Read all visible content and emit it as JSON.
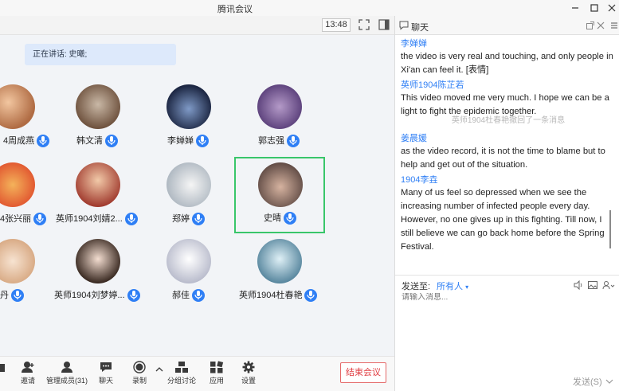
{
  "window": {
    "title": "腾讯会议"
  },
  "meeting": {
    "time": "13:48",
    "speaking": "正在讲话: 史曦;",
    "participants": [
      {
        "name": "4周成燕",
        "avatar_color": "#d99a6c"
      },
      {
        "name": "韩文清",
        "avatar_color": "#8a6f57"
      },
      {
        "name": "李婵婵",
        "avatar_color": "#2f3b58"
      },
      {
        "name": "郭志强",
        "avatar_color": "#8a6ca8"
      },
      {
        "name": "4张兴丽",
        "avatar_color": "#e67d3d"
      },
      {
        "name": "英师1904刘婧2...",
        "avatar_color": "#c86a54"
      },
      {
        "name": "郑婷",
        "avatar_color": "#d9dee3"
      },
      {
        "name": "史晴",
        "avatar_color": "#9a7a6e"
      },
      {
        "name": "丹",
        "avatar_color": "#e8c9a8"
      },
      {
        "name": "英师1904刘梦婷...",
        "avatar_color": "#6e5a4c"
      },
      {
        "name": "郝佳",
        "avatar_color": "#dcdde6"
      },
      {
        "name": "英师1904杜春艳",
        "avatar_color": "#7fb1c9"
      }
    ],
    "toolbar": {
      "invite": "邀请",
      "members": "管理成员(31)",
      "chat": "聊天",
      "record": "录制",
      "breakout": "分组讨论",
      "apps": "应用",
      "settings": "设置",
      "end": "结束会议"
    }
  },
  "chat": {
    "title": "聊天",
    "messages": [
      {
        "sender": "李婵婵",
        "text": "the video is very real and touching, and only people in Xi'an can feel  it. [表情]"
      },
      {
        "sender": "英师1904陈芷若",
        "text": "This video moved me very much. I hope we can be a light to fight the epidemic together.",
        "note": "英师1904杜春艳撤回了一条消息"
      },
      {
        "sender": "姜晨媛",
        "text": "as the video record, it is not the time to blame but to help and get out of the situation."
      },
      {
        "sender": "1904李垚",
        "text": "Many of us feel so depressed when we see the increasing number of infected people every day. However, no one gives up in this fighting. Till now, I still believe we can go back home before the Spring Festival."
      }
    ],
    "send_to_label": "发送至:",
    "send_to_value": "所有人",
    "input_placeholder": "请输入消息...",
    "send_label": "发送(S)"
  },
  "colors": {
    "accent": "#2f7ff5",
    "active_border": "#39c66a",
    "end_red": "#e0393e"
  }
}
